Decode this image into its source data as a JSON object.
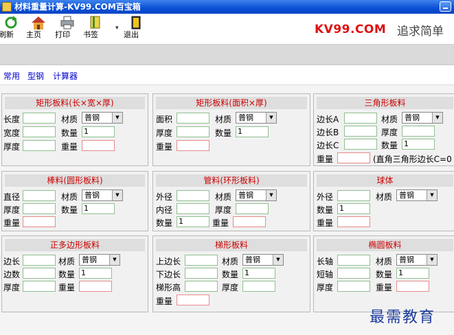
{
  "window": {
    "title": "材料重量计算-KV99.COM百宝箱"
  },
  "toolbar": {
    "refresh": "刷新",
    "home": "主页",
    "print": "打印",
    "bookmark": "书签",
    "exit": "退出",
    "dropdown_arrow": "▾"
  },
  "brand": {
    "name": "KV99.COM",
    "slogan": "追求简单"
  },
  "nav": {
    "common": "常用",
    "steel": "型钢",
    "calculator": "计算器"
  },
  "panels": {
    "rect_lwt": {
      "title": "矩形板料(长×宽×厚)",
      "length": "长度",
      "width": "宽度",
      "thickness": "厚度",
      "material": "材质",
      "material_value": "普钢",
      "quantity": "数量",
      "quantity_value": "1",
      "weight": "重量"
    },
    "rect_area": {
      "title": "矩形板料(面积×厚)",
      "area": "面积",
      "thickness": "厚度",
      "weight": "重量",
      "material": "材质",
      "material_value": "普钢",
      "quantity": "数量",
      "quantity_value": "1"
    },
    "triangle": {
      "title": "三角形板料",
      "side_a": "边长A",
      "side_b": "边长B",
      "side_c": "边长C",
      "weight": "重量",
      "material": "材质",
      "material_value": "普钢",
      "thickness": "厚度",
      "quantity": "数量",
      "quantity_value": "1",
      "note": "(直角三角形边长C=0"
    },
    "bar": {
      "title": "棒料(圆形板料)",
      "diameter": "直径",
      "thickness": "厚度",
      "weight": "重量",
      "material": "材质",
      "material_value": "普钢",
      "quantity": "数量",
      "quantity_value": "1"
    },
    "pipe": {
      "title": "管料(环形板料)",
      "outer": "外径",
      "inner": "内径",
      "quantity": "数量",
      "quantity_value": "1",
      "material": "材质",
      "material_value": "普钢",
      "thickness": "厚度",
      "weight": "重量"
    },
    "sphere": {
      "title": "球体",
      "outer": "外径",
      "quantity": "数量",
      "quantity_value": "1",
      "weight": "重量",
      "material": "材质",
      "material_value": "普钢"
    },
    "polygon": {
      "title": "正多边形板料",
      "side": "边长",
      "count": "边数",
      "thickness": "厚度",
      "material": "材质",
      "material_value": "普钢",
      "quantity": "数量",
      "quantity_value": "1",
      "weight": "重量"
    },
    "trapezoid": {
      "title": "梯形板料",
      "top": "上边长",
      "bottom": "下边长",
      "height": "梯形高",
      "weight": "重量",
      "material": "材质",
      "material_value": "普钢",
      "quantity": "数量",
      "quantity_value": "1",
      "thickness": "厚度"
    },
    "ellipse": {
      "title": "椭圆板料",
      "major": "长轴",
      "minor": "短轴",
      "thickness": "厚度",
      "material": "材质",
      "material_value": "普钢",
      "quantity": "数量",
      "quantity_value": "1",
      "weight": "重量"
    }
  },
  "watermark": "最需教育"
}
